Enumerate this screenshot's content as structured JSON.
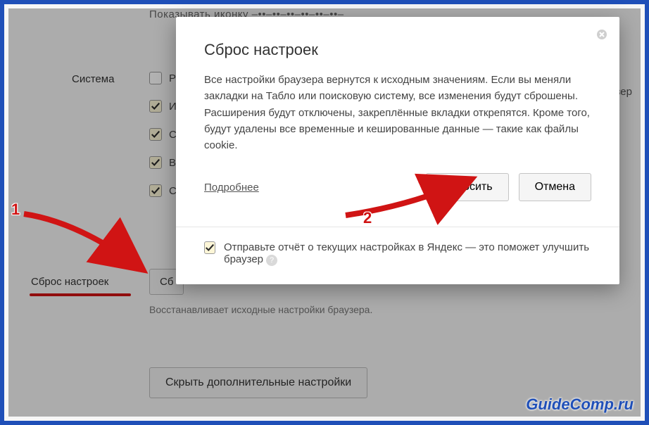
{
  "page": {
    "top_cut_text": "Показывать иконку –••–••–••–••–••–••–",
    "section_label": "Система",
    "checkboxes": [
      {
        "checked": false,
        "label": "Р"
      },
      {
        "checked": true,
        "label": "И"
      },
      {
        "checked": true,
        "label": "С"
      },
      {
        "checked": true,
        "label": "В"
      },
      {
        "checked": true,
        "label": "С"
      }
    ],
    "right_cut": "раузер",
    "reset_label": "Сброс настроек",
    "reset_button_cut": "Сб",
    "reset_desc": "Восстанавливает исходные настройки браузера.",
    "hide_button": "Скрыть дополнительные настройки"
  },
  "modal": {
    "title": "Сброс настроек",
    "body": "Все настройки браузера вернутся к исходным значениям. Если вы меняли закладки на Табло или поисковую систему, все изменения будут сброшены. Расширения будут отключены, закреплённые вкладки открепятся. Кроме того, будут удалены все временные и кешированные данные — такие как файлы cookie.",
    "more_link": "Подробнее",
    "confirm": "Сбросить",
    "cancel": "Отмена",
    "report_checked": true,
    "report_text": "Отправьте отчёт о текущих настройках в Яндекс — это поможет улучшить браузер"
  },
  "callouts": {
    "one": "1",
    "two": "2"
  },
  "watermark": "GuideComp.ru"
}
